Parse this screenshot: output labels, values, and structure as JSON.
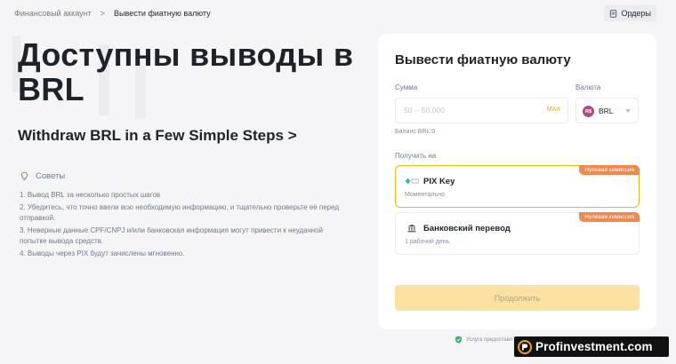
{
  "breadcrumb": {
    "parent": "Финансовый аккаунт",
    "separator": ">",
    "current": "Вывести фиатную валюту"
  },
  "header": {
    "orders_label": "Ордеры",
    "orders_icon": "document-icon"
  },
  "hero": {
    "title": "Доступны выводы в BRL",
    "subtitle": "Withdraw BRL in a Few Simple Steps >"
  },
  "tips": {
    "heading": "Советы",
    "icon": "lightbulb-icon",
    "items": [
      "1. Вывод BRL за несколько простых шагов",
      "2. Убедитесь, что точно ввели всю необходимую информацию, и тщательно проверьте её перед отправкой.",
      "3. Неверные данные CPF/CNPJ и/или банковская информация могут привести к неудачной попытке вывода средств.",
      "4. Выводы через PIX будут зачислены мгновенно."
    ]
  },
  "form": {
    "title": "Вывести фиатную валюту",
    "amount_label": "Сумма",
    "amount_value": "",
    "amount_placeholder": "50 -- 50,000",
    "max_label": "MAX",
    "balance": "Баланс BRL:0",
    "currency_label": "Валюта",
    "currency_icon_text": "R$",
    "currency_value": "BRL",
    "receive_label": "Получить на",
    "options": [
      {
        "title": "PIX Key",
        "subtitle": "Моментально",
        "badge": "Нулевая комиссия",
        "icon": "pix-icon",
        "selected": true
      },
      {
        "title": "Банковский перевод",
        "subtitle": "1 рабочий день",
        "badge": "Нулевая комиссия",
        "icon": "bank-icon",
        "selected": false
      }
    ],
    "continue_label": "Продолжить"
  },
  "footer": {
    "service_note": "Услуга предоставл",
    "service_icon": "shield-check-icon"
  },
  "watermark": {
    "text": "Profinvestment.com",
    "logo_icon": "profinvestment-logo-icon"
  },
  "colors": {
    "accent": "#f0b90b",
    "badge": "#f0894e",
    "continue_disabled": "#fbe2a3",
    "max": "#f0a11a",
    "currency_icon": "#b14c83",
    "check": "#3cb179"
  }
}
